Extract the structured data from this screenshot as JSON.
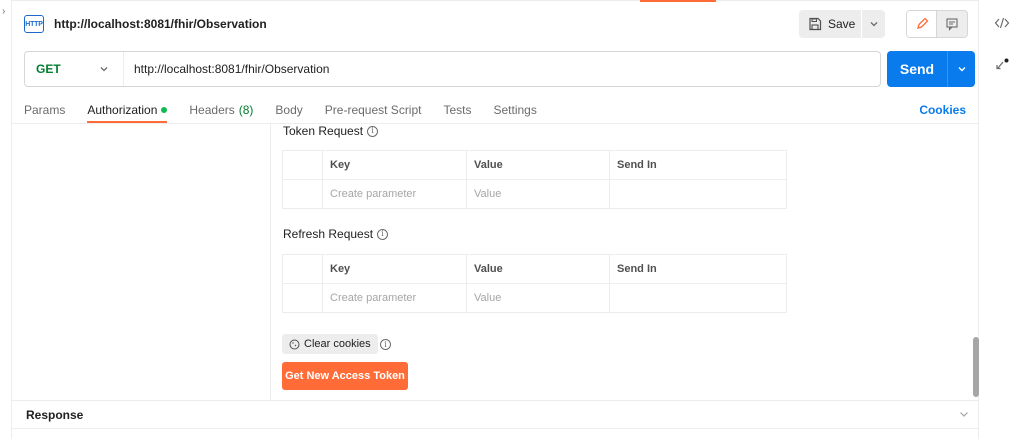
{
  "request": {
    "title": "http://localhost:8081/fhir/Observation",
    "icon_text": "HTTP",
    "save_label": "Save",
    "method": "GET",
    "url": "http://localhost:8081/fhir/Observation",
    "send_label": "Send"
  },
  "tabs": [
    {
      "label": "Params"
    },
    {
      "label": "Authorization",
      "active": true,
      "indicator": "green-dot"
    },
    {
      "label": "Headers",
      "count": "(8)"
    },
    {
      "label": "Body"
    },
    {
      "label": "Pre-request Script"
    },
    {
      "label": "Tests"
    },
    {
      "label": "Settings"
    }
  ],
  "cookies_label": "Cookies",
  "token_request": {
    "label": "Token Request",
    "columns": [
      "Key",
      "Value",
      "Send In"
    ],
    "row": {
      "key_placeholder": "Create parameter",
      "value_placeholder": "Value",
      "send_in": ""
    }
  },
  "refresh_request": {
    "label": "Refresh Request",
    "columns": [
      "Key",
      "Value",
      "Send In"
    ],
    "row": {
      "key_placeholder": "Create parameter",
      "value_placeholder": "Value",
      "send_in": ""
    }
  },
  "clear_cookies_label": "Clear cookies",
  "get_token_label": "Get New Access Token",
  "response_label": "Response",
  "colors": {
    "accent": "#ff6c37",
    "primary": "#097bed",
    "method_get": "#007f31",
    "active_dot": "#0cbb52"
  },
  "icons": [
    "http-icon",
    "save-icon",
    "chevron-down-icon",
    "edit-icon",
    "comment-icon",
    "code-icon",
    "sync-icon",
    "info-icon",
    "cookie-icon"
  ]
}
